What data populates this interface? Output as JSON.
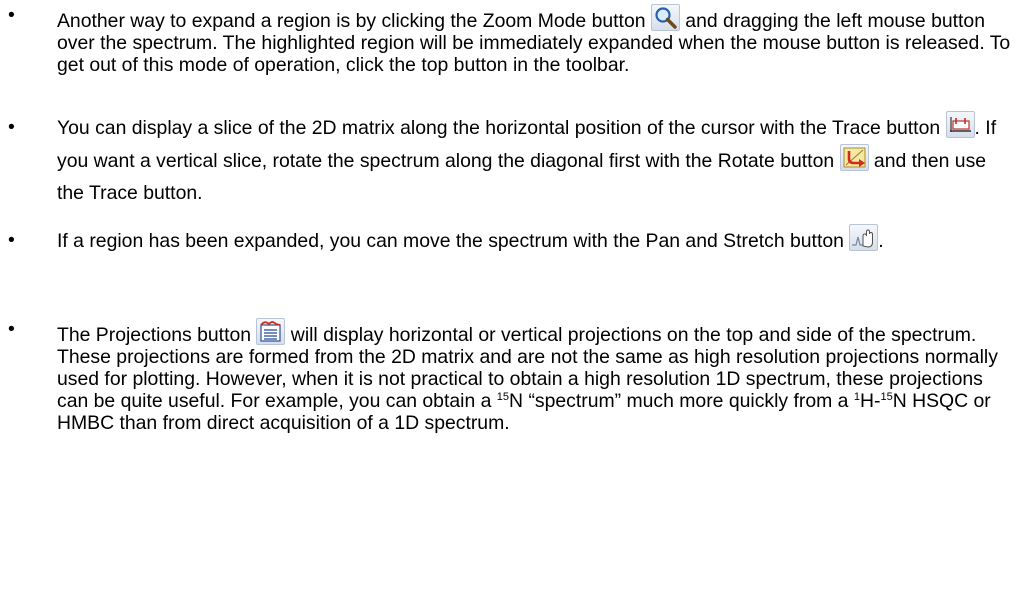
{
  "bullet_symbol": "•",
  "items": [
    {
      "a": "Another way to expand a region is by clicking the Zoom Mode button ",
      "b": " and dragging the left mouse button over the spectrum.  The highlighted region will be immediately expanded when the mouse button is released.  To get out of this mode of operation, click the top button in the toolbar.",
      "icon": "zoom-icon"
    },
    {
      "a": "You can display a slice of the 2D matrix along the horizontal position of the cursor with the Trace button ",
      "b": ". If you want a vertical slice, rotate the spectrum along the diagonal first with the Rotate button ",
      "c": " and then use the Trace button.",
      "icons": [
        "trace-icon",
        "rotate-icon"
      ]
    },
    {
      "a": "If a region has been expanded, you can move the spectrum with the Pan and Stretch button ",
      "b": ".",
      "icon": "pan-stretch-icon"
    },
    {
      "a": "The Projections button ",
      "b": " will display horizontal or vertical projections on the top and side of the spectrum.  These projections are formed from the 2D matrix and are not the same as high resolution projections normally used for plotting. However, when it is not practical to obtain a high resolution 1D spectrum, these projections can be quite useful.  For example, you can obtain a ",
      "sup1": "15",
      "c": "N “spectrum” much more quickly from a ",
      "sup2": "1",
      "d": "H-",
      "sup3": "15",
      "e": "N HSQC or HMBC than from direct acquisition of a 1D spectrum.",
      "icon": "projections-icon"
    }
  ]
}
